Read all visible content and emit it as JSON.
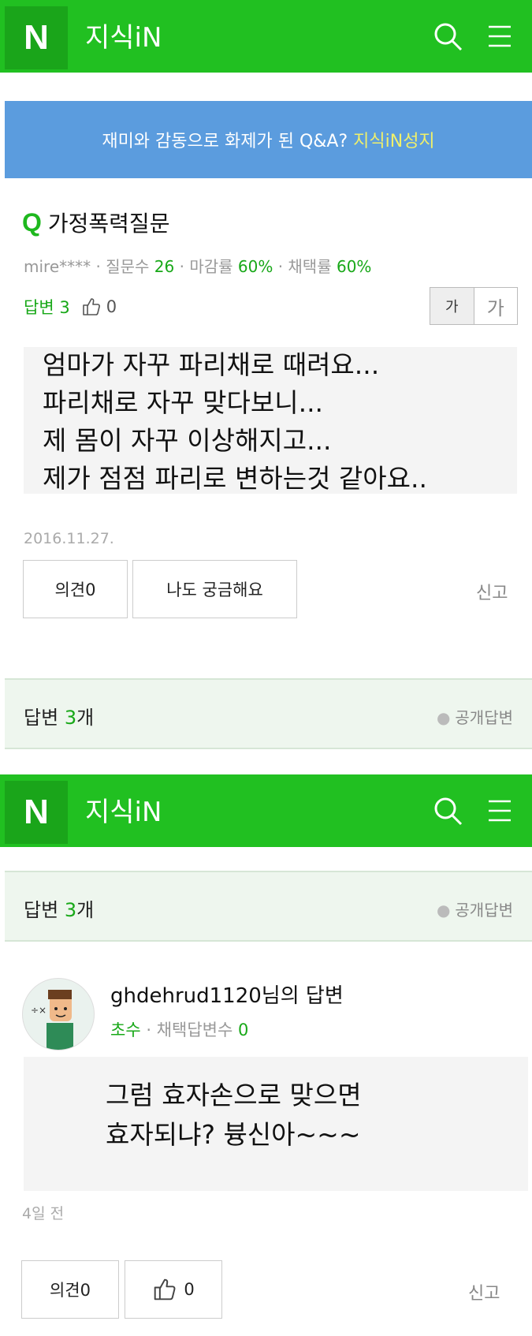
{
  "header": {
    "logo": "N",
    "title": "지식iN"
  },
  "banner": {
    "text": "재미와 감동으로 화제가 된 Q&A?",
    "highlight": "지식iN성지"
  },
  "question": {
    "marker": "Q",
    "title": "가정폭력질문",
    "author": "mire****",
    "stats": {
      "questions_label": "질문수",
      "questions": "26",
      "close_label": "마감률",
      "close_rate": "60%",
      "adopt_label": "채택률",
      "adopt_rate": "60%"
    },
    "answers_label": "답변 3",
    "likes": "0",
    "font_small": "가",
    "font_large": "가",
    "body_lines": [
      "엄마가 자꾸 파리채로 때려요...",
      "파리채로 자꾸 맞다보니...",
      "제 몸이 자꾸 이상해지고...",
      "제가 점점 파리로 변하는것 같아요.."
    ],
    "date": "2016.11.27.",
    "opinion_button": "의견0",
    "curious_button": "나도 궁금해요",
    "report": "신고"
  },
  "answers_section": {
    "label": "답변",
    "count": "3",
    "suffix": "개",
    "public": "공개답변"
  },
  "answer": {
    "author": "ghdehrud1120님의 답변",
    "level": "초수",
    "adopted_label": "채택답변수",
    "adopted_count": "0",
    "body_lines": [
      "그럼 효자손으로 맞으면",
      "효자되냐? 븅신아~~~"
    ],
    "time": "4일 전",
    "opinion_button": "의견0",
    "likes": "0",
    "report": "신고"
  },
  "colors": {
    "brand": "#21c021",
    "banner": "#5b9cde",
    "accent_text": "#18a818"
  }
}
